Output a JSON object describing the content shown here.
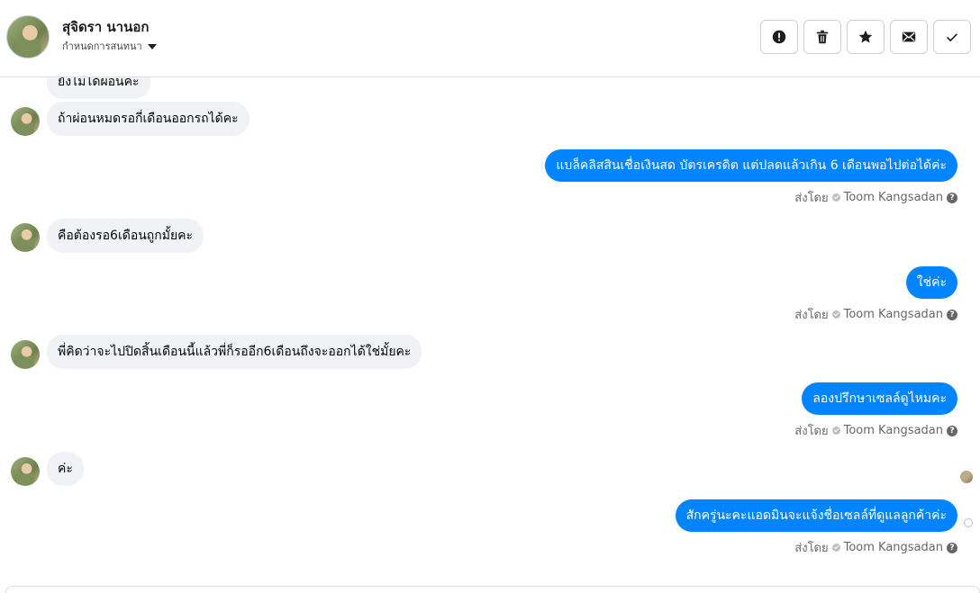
{
  "contact": {
    "name": "สุจิดรา นานอก",
    "assign_label": "กำหนดการสนทนา"
  },
  "actions": [
    {
      "icon": "alert-icon",
      "label": ""
    },
    {
      "icon": "trash-icon",
      "label": ""
    },
    {
      "icon": "star-icon",
      "label": ""
    },
    {
      "icon": "mail-icon",
      "label": ""
    },
    {
      "icon": "check-icon",
      "label": ""
    }
  ],
  "messages": {
    "in_0": "ยังไม่ได้ผ่อนค่ะ",
    "in_1": "ถ้าผ่อนหมดรอกี่เดือนออกรถได้คะ",
    "out_1": "แบล็คลิสสินเชื่อเงินสด บัตรเครดิต แต่ปลดแล้วเกิน 6 เดือนพอไปต่อได้ค่ะ",
    "in_2": "คือต้องรอ6เดือนถูกมั้ยคะ",
    "out_2": "ใช่ค่ะ",
    "in_3": "พี่คิดว่าจะไปปิดสิ้นเดือนนี้แล้วพี่ก็รออีก6เดือนถึงจะออกได้ใช่มั้ยคะ",
    "out_3": "ลองปรึกษาเซลล์ดูไหมคะ",
    "in_4": "ค่ะ",
    "out_4": "สักครู่นะคะแอดมินจะแจ้งชื่อเซลล์ที่ดูแลลูกค้าค่ะ"
  },
  "sent_meta": {
    "prefix": "ส่งโดย",
    "sender": "Toom Kangsadan",
    "help": "?"
  },
  "colors": {
    "outgoing": "#0084ff",
    "incoming": "#f0f2f5"
  }
}
